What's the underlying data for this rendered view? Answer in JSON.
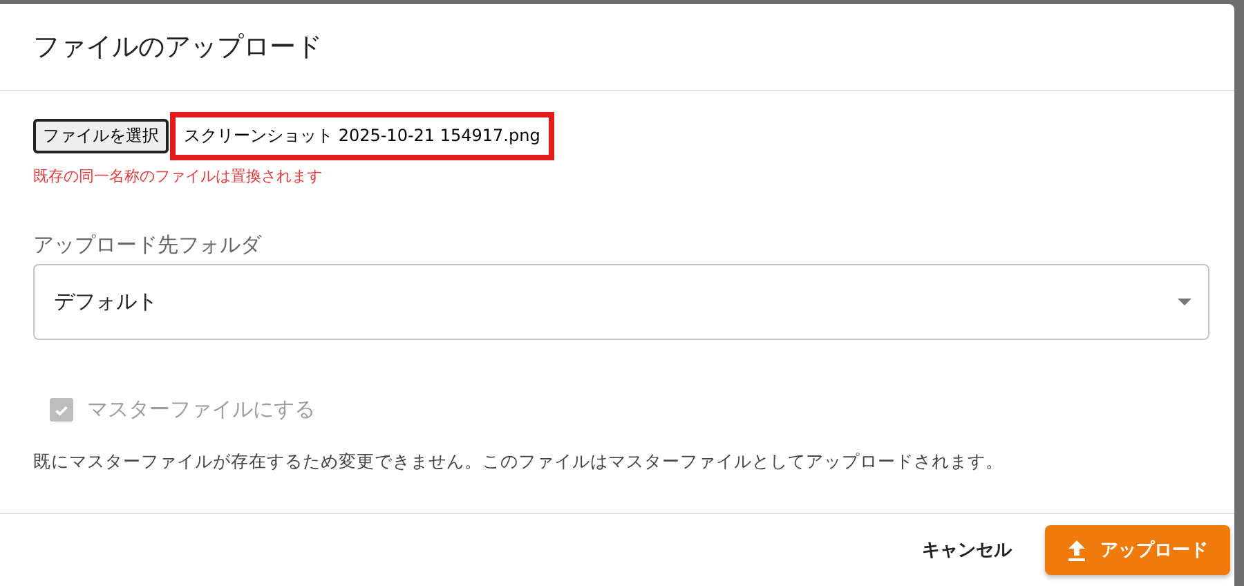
{
  "dialog": {
    "title": "ファイルのアップロード"
  },
  "file_input": {
    "button": "ファイルを選択",
    "file_name": "スクリーンショット 2025-10-21 154917.png",
    "highlighted": true
  },
  "warning": "既存の同一名称のファイルは置換されます",
  "folder_select": {
    "label": "アップロード先フォルダ",
    "value": "デフォルト"
  },
  "master_checkbox": {
    "label": "マスターファイルにする",
    "checked": true,
    "disabled": true
  },
  "note": "既にマスターファイルが存在するため変更できません。このファイルはマスターファイルとしてアップロードされます。",
  "buttons": [
    {
      "kind": "text",
      "label": "キャンセル"
    },
    {
      "kind": "primary",
      "label": "アップロード"
    }
  ]
}
